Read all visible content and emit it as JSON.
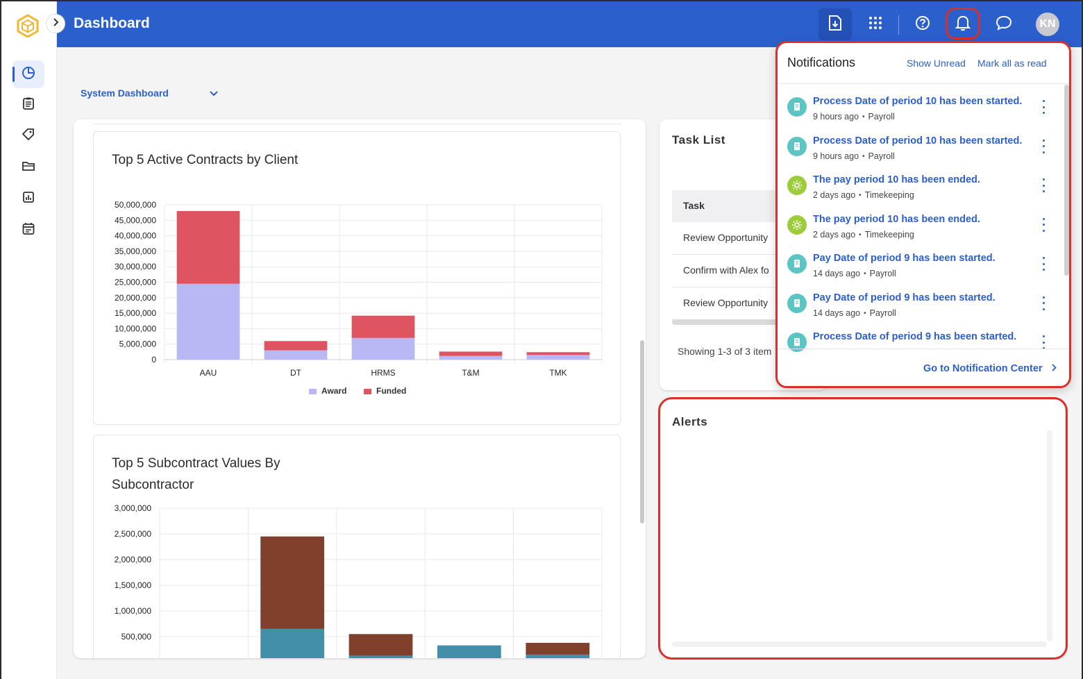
{
  "header": {
    "title": "Dashboard",
    "avatar_initials": "KN",
    "brand_color": "#2b5fcc"
  },
  "dashboard_selector": {
    "value": "System Dashboard"
  },
  "sidebar": {
    "items": [
      {
        "icon": "pie-chart-icon",
        "active": true
      },
      {
        "icon": "clipboard-icon"
      },
      {
        "icon": "tags-icon"
      },
      {
        "icon": "folder-icon"
      },
      {
        "icon": "report-icon"
      },
      {
        "icon": "calendar-icon"
      }
    ]
  },
  "chart_data": [
    {
      "type": "bar",
      "stacked": true,
      "title": "Top 5 Active Contracts by Client",
      "categories": [
        "AAU",
        "DT",
        "HRMS",
        "T&M",
        "TMK"
      ],
      "series": [
        {
          "name": "Award",
          "color": "#b8b8f5",
          "values": [
            24500000,
            3000000,
            7000000,
            1200000,
            1500000
          ]
        },
        {
          "name": "Funded",
          "color": "#de5461",
          "values": [
            23500000,
            3000000,
            7200000,
            1400000,
            900000
          ]
        }
      ],
      "ylim": [
        0,
        50000000
      ],
      "yticks": [
        "0",
        "5,000,000",
        "10,000,000",
        "15,000,000",
        "20,000,000",
        "25,000,000",
        "30,000,000",
        "35,000,000",
        "40,000,000",
        "45,000,000",
        "50,000,000"
      ],
      "legend": "bottom"
    },
    {
      "type": "bar",
      "stacked": true,
      "title": "Top 5 Subcontract Values By Subcontractor",
      "title_lines": [
        "Top 5 Subcontract Values By",
        "Subcontractor"
      ],
      "series": [
        {
          "color": "#418fa8",
          "values": [
            0,
            650000,
            130000,
            330000,
            150000
          ]
        },
        {
          "color": "#80402b",
          "values": [
            0,
            1800000,
            420000,
            0,
            230000
          ]
        }
      ],
      "visible_ylim": [
        300000,
        3000000
      ],
      "yticks": [
        "500,000",
        "1,000,000",
        "1,500,000",
        "2,000,000",
        "2,500,000",
        "3,000,000"
      ]
    }
  ],
  "task_list": {
    "title": "Task List",
    "column": "Task",
    "rows": [
      "Review Opportunity",
      "Confirm with Alex fo",
      "Review Opportunity"
    ],
    "footer": "Showing 1-3 of 3 item"
  },
  "alerts": {
    "title": "Alerts"
  },
  "notifications": {
    "title": "Notifications",
    "show_unread": "Show Unread",
    "mark_all": "Mark all as read",
    "footer_link": "Go to Notification Center",
    "items": [
      {
        "text": "Process Date of period 10 has been started.",
        "time": "9 hours ago",
        "source": "Payroll",
        "kind": "payroll"
      },
      {
        "text": "Process Date of period 10 has been started.",
        "time": "9 hours ago",
        "source": "Payroll",
        "kind": "payroll"
      },
      {
        "text": "The pay period 10 has been ended.",
        "time": "2 days ago",
        "source": "Timekeeping",
        "kind": "time"
      },
      {
        "text": "The pay period 10 has been ended.",
        "time": "2 days ago",
        "source": "Timekeeping",
        "kind": "time"
      },
      {
        "text": "Pay Date of period 9 has been started.",
        "time": "14 days ago",
        "source": "Payroll",
        "kind": "payroll"
      },
      {
        "text": "Pay Date of period 9 has been started.",
        "time": "14 days ago",
        "source": "Payroll",
        "kind": "payroll"
      },
      {
        "text": "Process Date of period 9 has been started.",
        "time": "",
        "source": "",
        "kind": "payroll"
      }
    ]
  }
}
